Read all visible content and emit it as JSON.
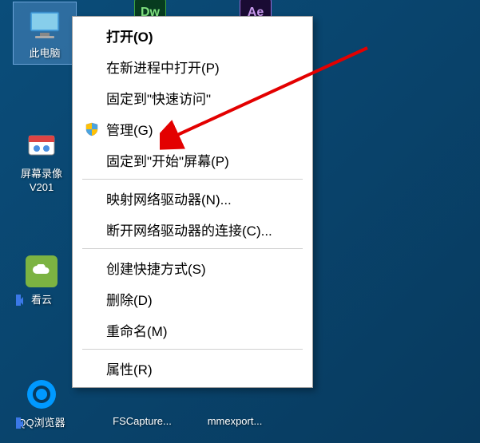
{
  "desktop": {
    "icons": [
      {
        "name": "this-pc",
        "label": "此电脑"
      },
      {
        "name": "screen-recorder",
        "label": "屏幕录像\nV201"
      },
      {
        "name": "kanyun",
        "label": "看云"
      },
      {
        "name": "qq-browser",
        "label": "QQ浏览器"
      },
      {
        "name": "fscapture",
        "label": "FSCapture..."
      },
      {
        "name": "mmexport",
        "label": "mmexport..."
      },
      {
        "name": "dreamweaver",
        "label": "Dw"
      },
      {
        "name": "aftereffects",
        "label": "Ae"
      }
    ]
  },
  "context_menu": {
    "items": [
      {
        "label": "打开(O)",
        "bold": true,
        "icon": ""
      },
      {
        "label": "在新进程中打开(P)",
        "icon": ""
      },
      {
        "label": "固定到\"快速访问\"",
        "icon": ""
      },
      {
        "label": "管理(G)",
        "icon": "shield"
      },
      {
        "label": "固定到\"开始\"屏幕(P)",
        "icon": ""
      },
      {
        "sep": true
      },
      {
        "label": "映射网络驱动器(N)...",
        "icon": ""
      },
      {
        "label": "断开网络驱动器的连接(C)...",
        "icon": ""
      },
      {
        "sep": true
      },
      {
        "label": "创建快捷方式(S)",
        "icon": ""
      },
      {
        "label": "删除(D)",
        "icon": ""
      },
      {
        "label": "重命名(M)",
        "icon": ""
      },
      {
        "sep": true
      },
      {
        "label": "属性(R)",
        "icon": ""
      }
    ]
  }
}
